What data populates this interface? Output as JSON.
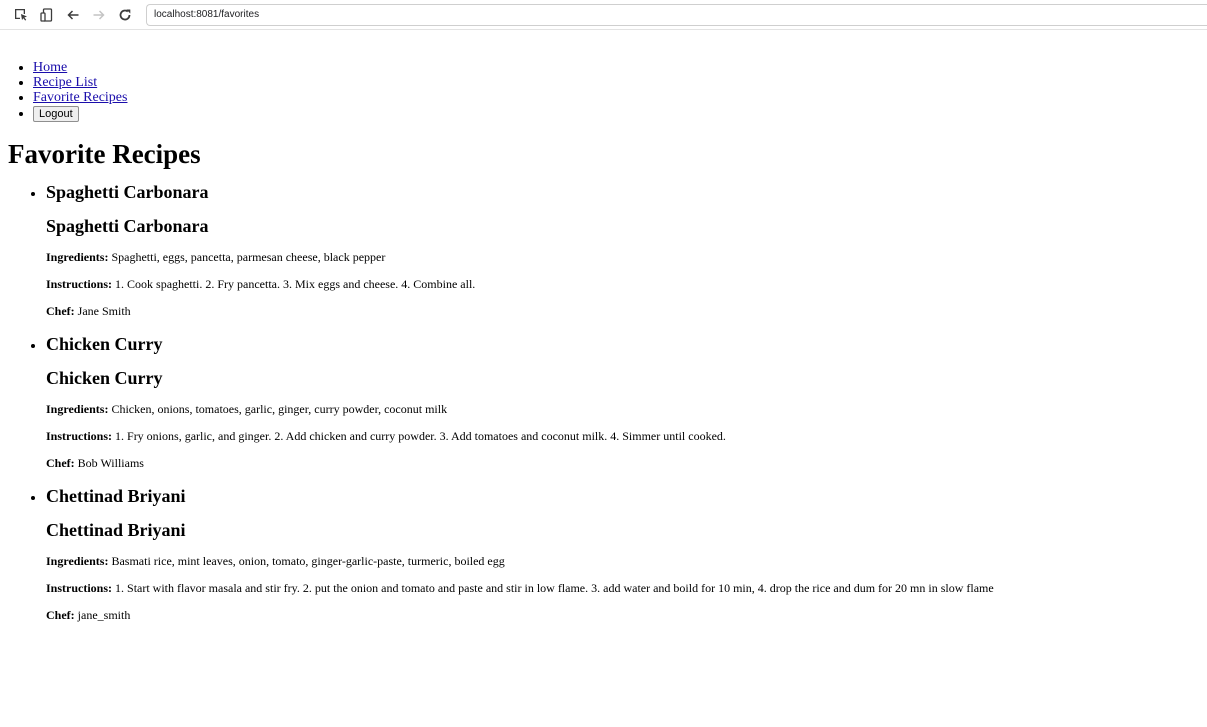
{
  "browser": {
    "url": "localhost:8081/favorites",
    "icons": [
      "inspect-icon",
      "device-icon",
      "back-icon",
      "forward-icon",
      "reload-icon"
    ]
  },
  "nav": {
    "items": [
      {
        "label": "Home"
      },
      {
        "label": "Recipe List"
      },
      {
        "label": "Favorite Recipes"
      }
    ],
    "logout_label": "Logout"
  },
  "page": {
    "title": "Favorite Recipes"
  },
  "labels": {
    "ingredients": "Ingredients:",
    "instructions": "Instructions:",
    "chef": "Chef:"
  },
  "recipes": [
    {
      "name": "Spaghetti Carbonara",
      "heading": "Spaghetti Carbonara",
      "ingredients": "Spaghetti, eggs, pancetta, parmesan cheese, black pepper",
      "instructions": "1. Cook spaghetti. 2. Fry pancetta. 3. Mix eggs and cheese. 4. Combine all.",
      "chef": "Jane Smith"
    },
    {
      "name": "Chicken Curry",
      "heading": "Chicken Curry",
      "ingredients": "Chicken, onions, tomatoes, garlic, ginger, curry powder, coconut milk",
      "instructions": "1. Fry onions, garlic, and ginger. 2. Add chicken and curry powder. 3. Add tomatoes and coconut milk. 4. Simmer until cooked.",
      "chef": "Bob Williams"
    },
    {
      "name": "Chettinad Briyani",
      "heading": "Chettinad Briyani",
      "ingredients": "Basmati rice, mint leaves, onion, tomato, ginger-garlic-paste, turmeric, boiled egg",
      "instructions": "1. Start with flavor masala and stir fry. 2. put the onion and tomato and paste and stir in low flame. 3. add water and boild for 10 min, 4. drop the rice and dum for 20 mn in slow flame",
      "chef": "jane_smith"
    }
  ]
}
